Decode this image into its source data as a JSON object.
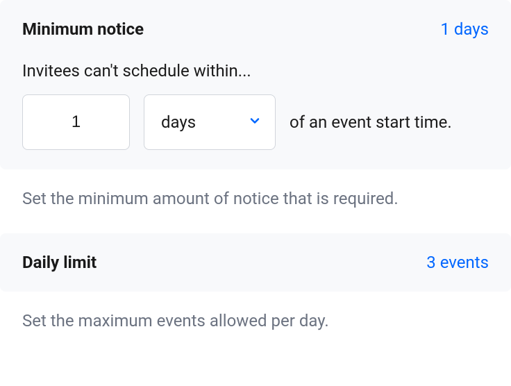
{
  "minimumNotice": {
    "title": "Minimum notice",
    "summary": "1 days",
    "label": "Invitees can't schedule within...",
    "value": "1",
    "unitSelected": "days",
    "trailingText": "of an event start time.",
    "description": "Set the minimum amount of notice that is required."
  },
  "dailyLimit": {
    "title": "Daily limit",
    "summary": "3 events",
    "description": "Set the maximum events allowed per day."
  }
}
